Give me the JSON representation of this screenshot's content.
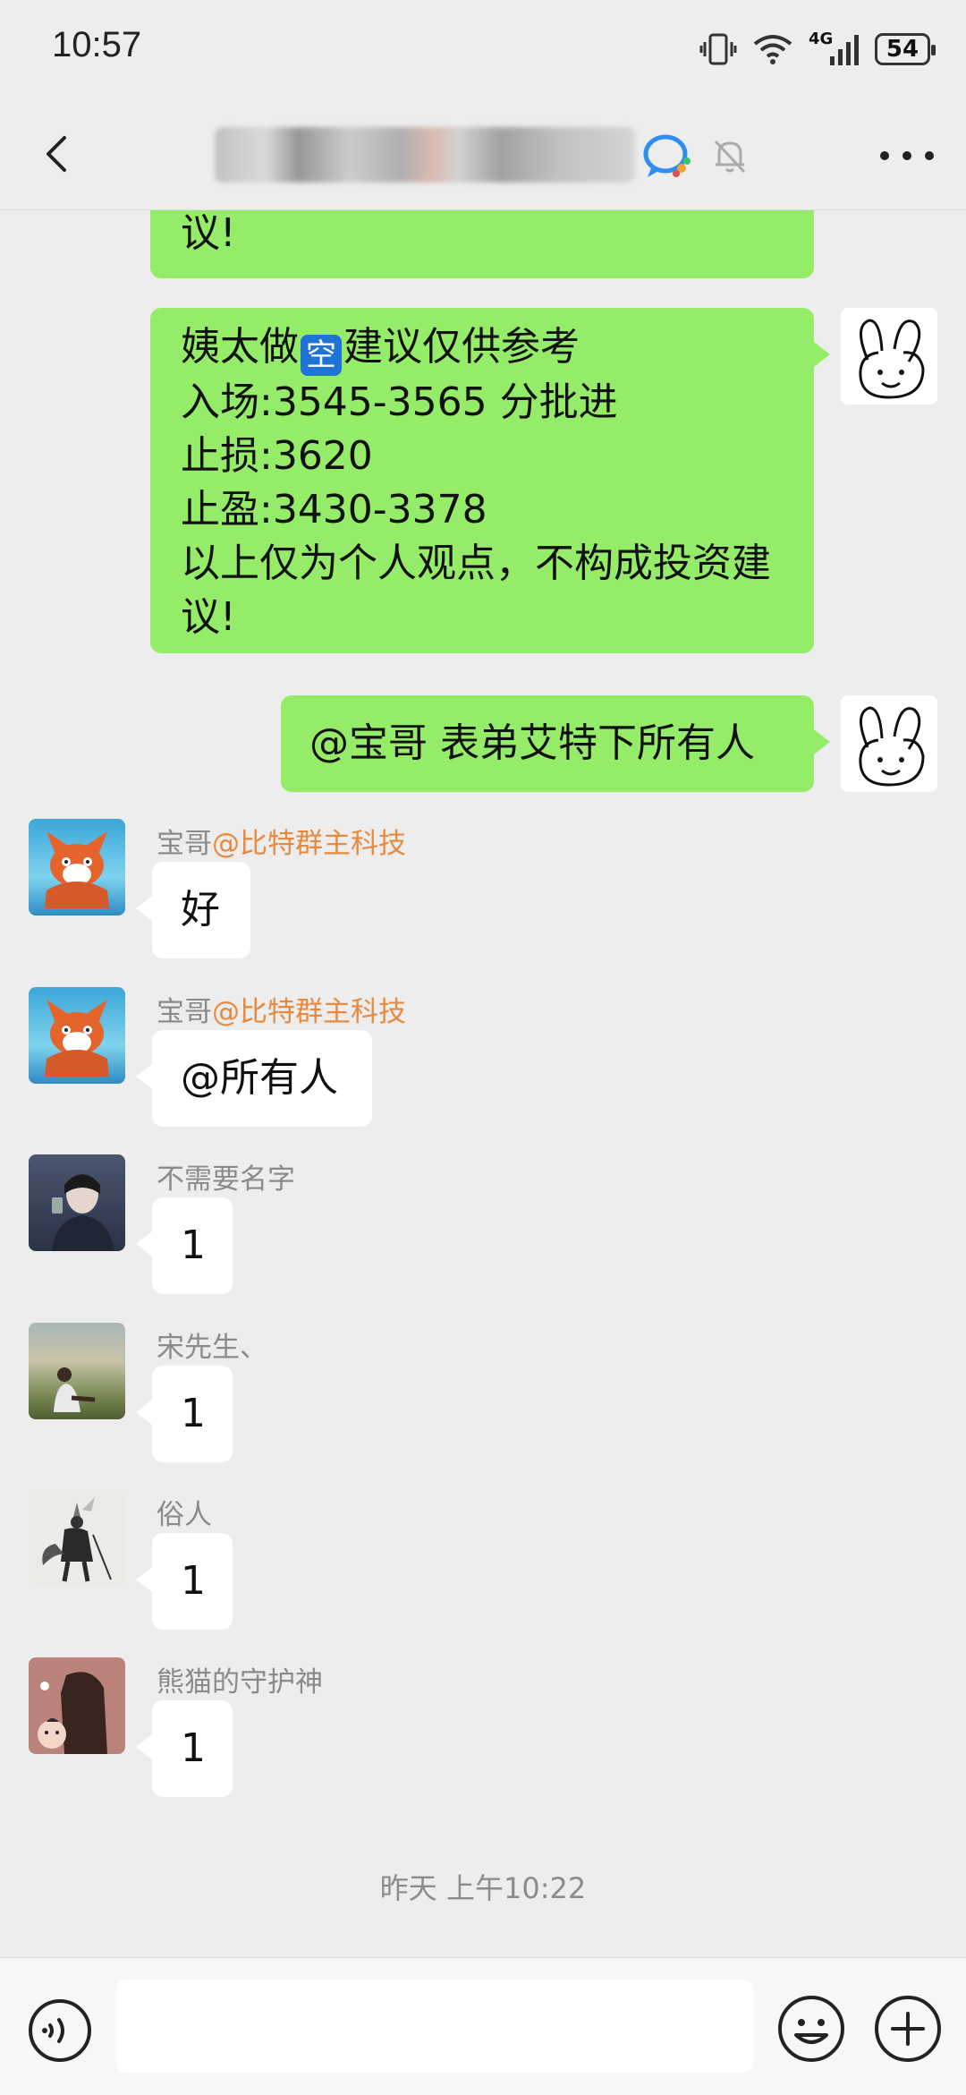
{
  "status_bar": {
    "time": "10:57",
    "network": "4G",
    "battery": "54"
  },
  "header": {
    "icons": [
      "back-icon",
      "chat-badge-icon",
      "mute-bell-icon",
      "more-icon"
    ]
  },
  "messages": {
    "m1_partial": "议!",
    "m2": {
      "line1_a": "姨太做",
      "line1_badge": "空",
      "line1_b": "建议仅供参考",
      "line2": "入场:3545-3565 分批进",
      "line3": "止损:3620",
      "line4": "止盈:3430-3378",
      "line5": "以上仅为个人观点，不构成投资建",
      "line6": "议!"
    },
    "m3": "@宝哥  表弟艾特下所有人",
    "m4": {
      "sender": "宝哥",
      "mention": "@比特群主科技",
      "text": "好"
    },
    "m5": {
      "sender": "宝哥",
      "mention": "@比特群主科技",
      "text": "@所有人"
    },
    "m6": {
      "sender": "不需要名字",
      "text": "1"
    },
    "m7": {
      "sender": "宋先生、",
      "text": "1"
    },
    "m8": {
      "sender": "俗人",
      "text": "1"
    },
    "m9": {
      "sender": "熊猫的守护神",
      "text": "1"
    }
  },
  "timestamp": "昨天 上午10:22",
  "input": {
    "placeholder": ""
  },
  "colors": {
    "self_bubble": "#95ec69",
    "other_bubble": "#ffffff",
    "mention": "#e88a3e",
    "background": "#ededed"
  }
}
